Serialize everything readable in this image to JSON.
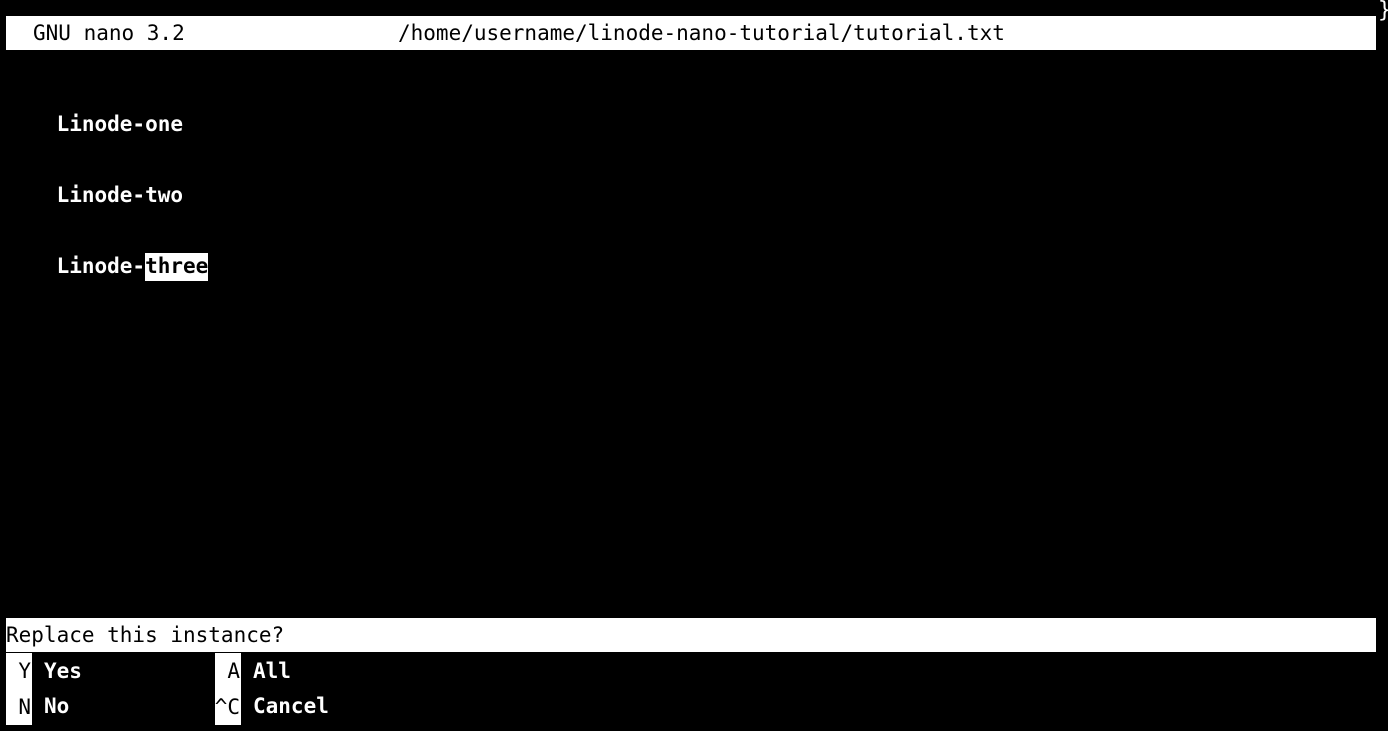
{
  "titlebar": {
    "app_version": "GNU nano 3.2",
    "file_path": "/home/username/linode-nano-tutorial/tutorial.txt"
  },
  "editor": {
    "lines": [
      {
        "prefix": "Linode-one",
        "highlight": ""
      },
      {
        "prefix": "Linode-two",
        "highlight": ""
      },
      {
        "prefix": "Linode-",
        "highlight": "three"
      }
    ]
  },
  "prompt": {
    "text": "Replace this instance?"
  },
  "shortcuts": [
    {
      "key": "Y",
      "label": "Yes"
    },
    {
      "key": "N",
      "label": "No"
    },
    {
      "key": "A",
      "label": "All"
    },
    {
      "key": "^C",
      "label": "Cancel"
    }
  ],
  "colors": {
    "background": "#000000",
    "foreground": "#ffffff",
    "inverse_bg": "#ffffff",
    "inverse_fg": "#000000"
  }
}
